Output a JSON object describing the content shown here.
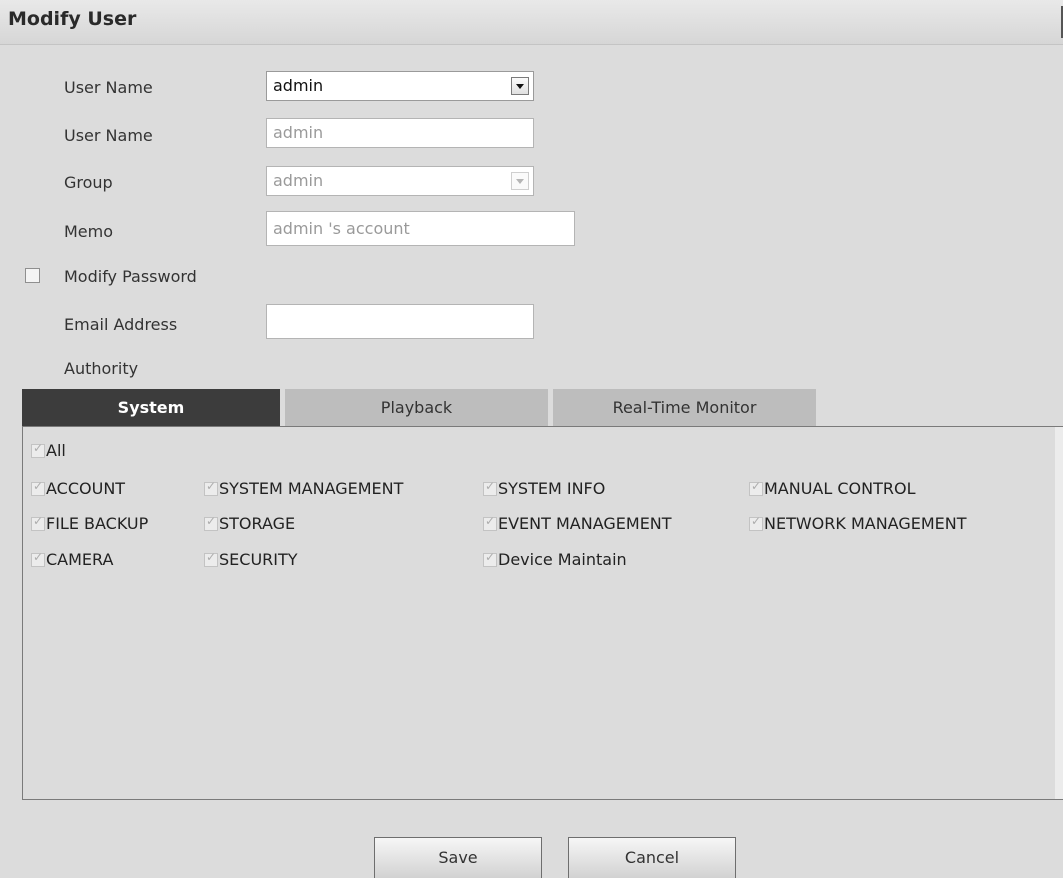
{
  "window": {
    "title": "Modify User"
  },
  "form": {
    "user_select_label": "User Name",
    "user_select_value": "admin",
    "user_name_label": "User Name",
    "user_name_value": "admin",
    "group_label": "Group",
    "group_value": "admin",
    "memo_label": "Memo",
    "memo_value": "admin 's account",
    "modify_password_label": "Modify Password",
    "email_label": "Email Address",
    "email_value": "",
    "authority_label": "Authority"
  },
  "tabs": [
    {
      "label": "System",
      "active": true
    },
    {
      "label": "Playback",
      "active": false
    },
    {
      "label": "Real-Time Monitor",
      "active": false
    }
  ],
  "permissions": {
    "all": "All",
    "items": [
      "ACCOUNT",
      "SYSTEM MANAGEMENT",
      "SYSTEM INFO",
      "MANUAL CONTROL",
      "FILE BACKUP",
      "STORAGE",
      "EVENT MANAGEMENT",
      "NETWORK MANAGEMENT",
      "CAMERA",
      "SECURITY",
      "Device Maintain"
    ]
  },
  "buttons": {
    "save": "Save",
    "cancel": "Cancel"
  },
  "icons": {
    "dropdown": "chevron-down-icon",
    "check": "check-icon"
  }
}
